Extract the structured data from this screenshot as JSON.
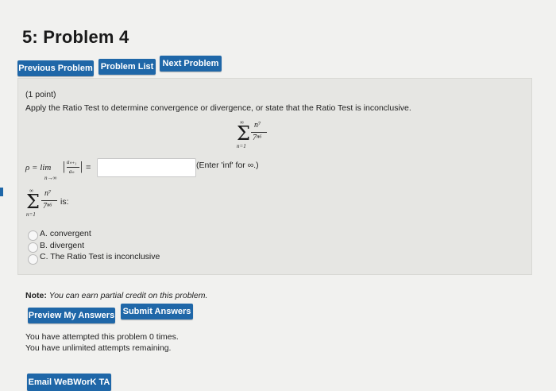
{
  "page_title": "5: Problem 4",
  "nav": {
    "previous": "Previous Problem",
    "list": "Problem List",
    "next": "Next Problem"
  },
  "problem": {
    "points": "(1 point)",
    "instruction": "Apply the Ratio Test to determine convergence or divergence, or state that the Ratio Test is inconclusive.",
    "series": {
      "sum_top": "∞",
      "sum_bottom": "n=1",
      "numerator": "n⁷",
      "denominator": "7ⁿ⁶"
    },
    "rho_label": "ρ = lim",
    "rho_sub": "n→∞",
    "ratio_num": "aₙ₊₁",
    "ratio_den": "aₙ",
    "equals": "=",
    "answer_value": "",
    "hint": "(Enter 'inf' for ∞.)",
    "is_label": "is:",
    "options": [
      "A. convergent",
      "B. divergent",
      "C. The Ratio Test is inconclusive"
    ]
  },
  "note": {
    "bold": "Note:",
    "text": "You can earn partial credit on this problem."
  },
  "actions": {
    "preview": "Preview My Answers",
    "submit": "Submit Answers"
  },
  "attempts": {
    "line1": "You have attempted this problem 0 times.",
    "line2": "You have unlimited attempts remaining."
  },
  "email": "Email WeBWorK TA",
  "colors": {
    "button": "#1f67a8",
    "panel": "#e6e6e3",
    "background": "#f1f1ef"
  }
}
